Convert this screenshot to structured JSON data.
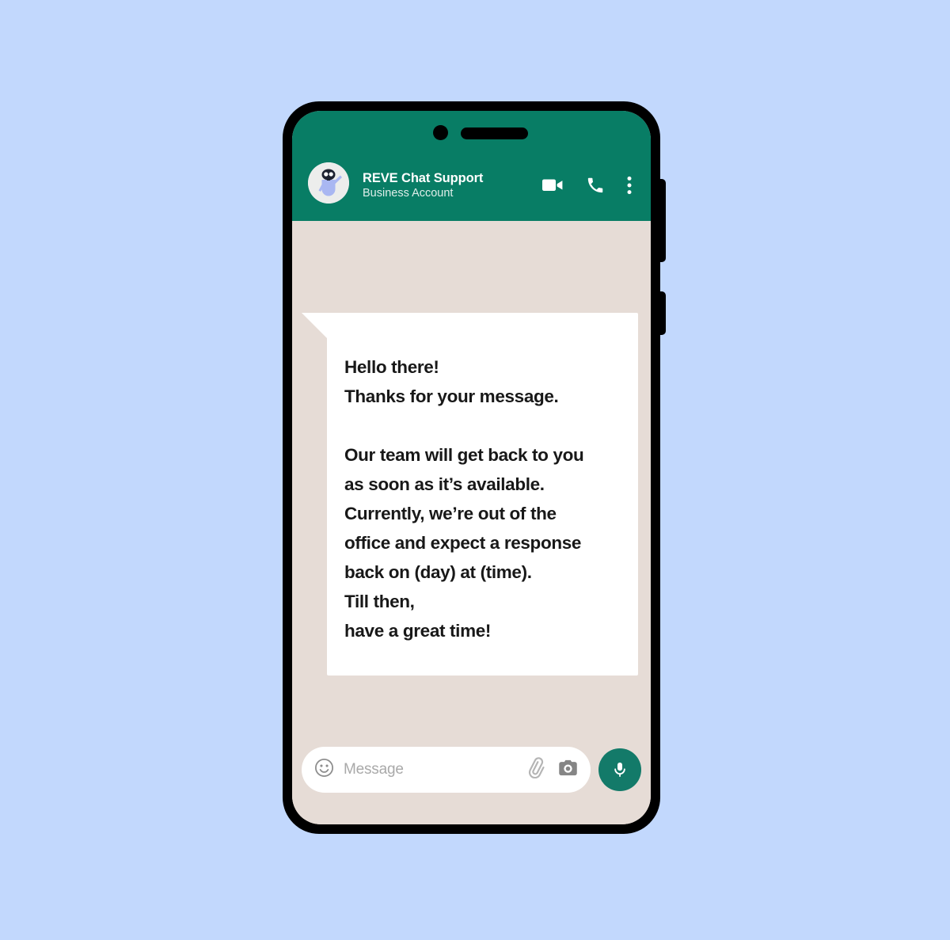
{
  "theme": {
    "page_background": "#c2d8fd",
    "phone_bezel": "#000000",
    "header_green": "#087d65",
    "chat_background": "#e6dcd6",
    "bubble_background": "#ffffff",
    "bubble_text": "#181818",
    "mic_button": "#137a69",
    "placeholder_text": "#a9a9a9",
    "header_subtitle": "#dfeeea"
  },
  "header": {
    "contact_name": "REVE Chat Support",
    "subtitle": "Business Account",
    "avatar_name": "chatbot-robot-avatar",
    "actions": [
      {
        "name": "video-call-icon",
        "label": "Video call"
      },
      {
        "name": "voice-call-icon",
        "label": "Voice call"
      },
      {
        "name": "more-options-icon",
        "label": "More options"
      }
    ]
  },
  "conversation": {
    "incoming_message": {
      "lines": [
        "Hello there!",
        "Thanks for your message.",
        "",
        "Our team will get back to you",
        "as soon as it’s available.",
        "Currently, we’re out of the",
        "office and expect a response",
        "back on (day) at (time).",
        "Till then,",
        "have a great time!"
      ]
    }
  },
  "composer": {
    "placeholder": "Message",
    "emoji_icon": "emoji-smiley-icon",
    "attach_icon": "attach-paperclip-icon",
    "camera_icon": "camera-icon",
    "mic_icon": "microphone-icon"
  },
  "hardware": {
    "front_camera": "front-camera-dot",
    "earpiece": "earpiece-speaker",
    "volume_button": "volume-button",
    "power_button": "power-button"
  }
}
